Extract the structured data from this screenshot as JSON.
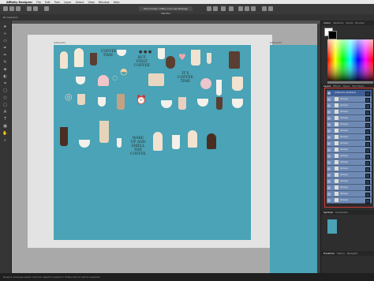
{
  "menubar": {
    "app_name": "Affinity Designer",
    "items": [
      "File",
      "Edit",
      "Text",
      "Layer",
      "Select",
      "View",
      "Window",
      "Help"
    ]
  },
  "document": {
    "title": "Hand-drawn coffee icons set.afdesign (50.0%)"
  },
  "context": {
    "label": "No Selection"
  },
  "artboards": {
    "first": "Artboard1",
    "second": "Artboard2"
  },
  "artwork": {
    "text_coffee_time": "COFFEE TIME",
    "text_but_first": "BUT FIRST COFFEE",
    "text_its_coffee": "IT'S COFFEE TIME",
    "text_wake_up": "WAKE UP AND SMELL THE COFFEE"
  },
  "panels": {
    "top_tabs": [
      "Colour",
      "Swatches",
      "Stroke",
      "Brushes"
    ],
    "layer_tabs": [
      "Layers",
      "Effects",
      "Styles",
      "Text Styles"
    ],
    "layers_header": "Artboard1 (Artboard)",
    "layer_names": [
      "(Group)",
      "(Group)",
      "(Group)",
      "(Group)",
      "(Group)",
      "(Group)",
      "(Group)",
      "(Group)",
      "(Group)",
      "(Group)",
      "(Group)",
      "(Group)",
      "(Group)",
      "(Group)",
      "(Group)",
      "(Group)",
      "(Group)",
      "(Group)"
    ],
    "bottom_tabs": [
      "Transform",
      "History",
      "Navigator"
    ],
    "bottom_tabs2": [
      "Symbols",
      "Constraints"
    ]
  },
  "status": {
    "text": "Drag to marquee select. Click an object to select it. Shift+click to add to selection."
  },
  "colors": {
    "artboard_teal": "#4aa3b6",
    "layer_selected": "#6e8ab4",
    "highlight_red": "#d23a3a"
  }
}
